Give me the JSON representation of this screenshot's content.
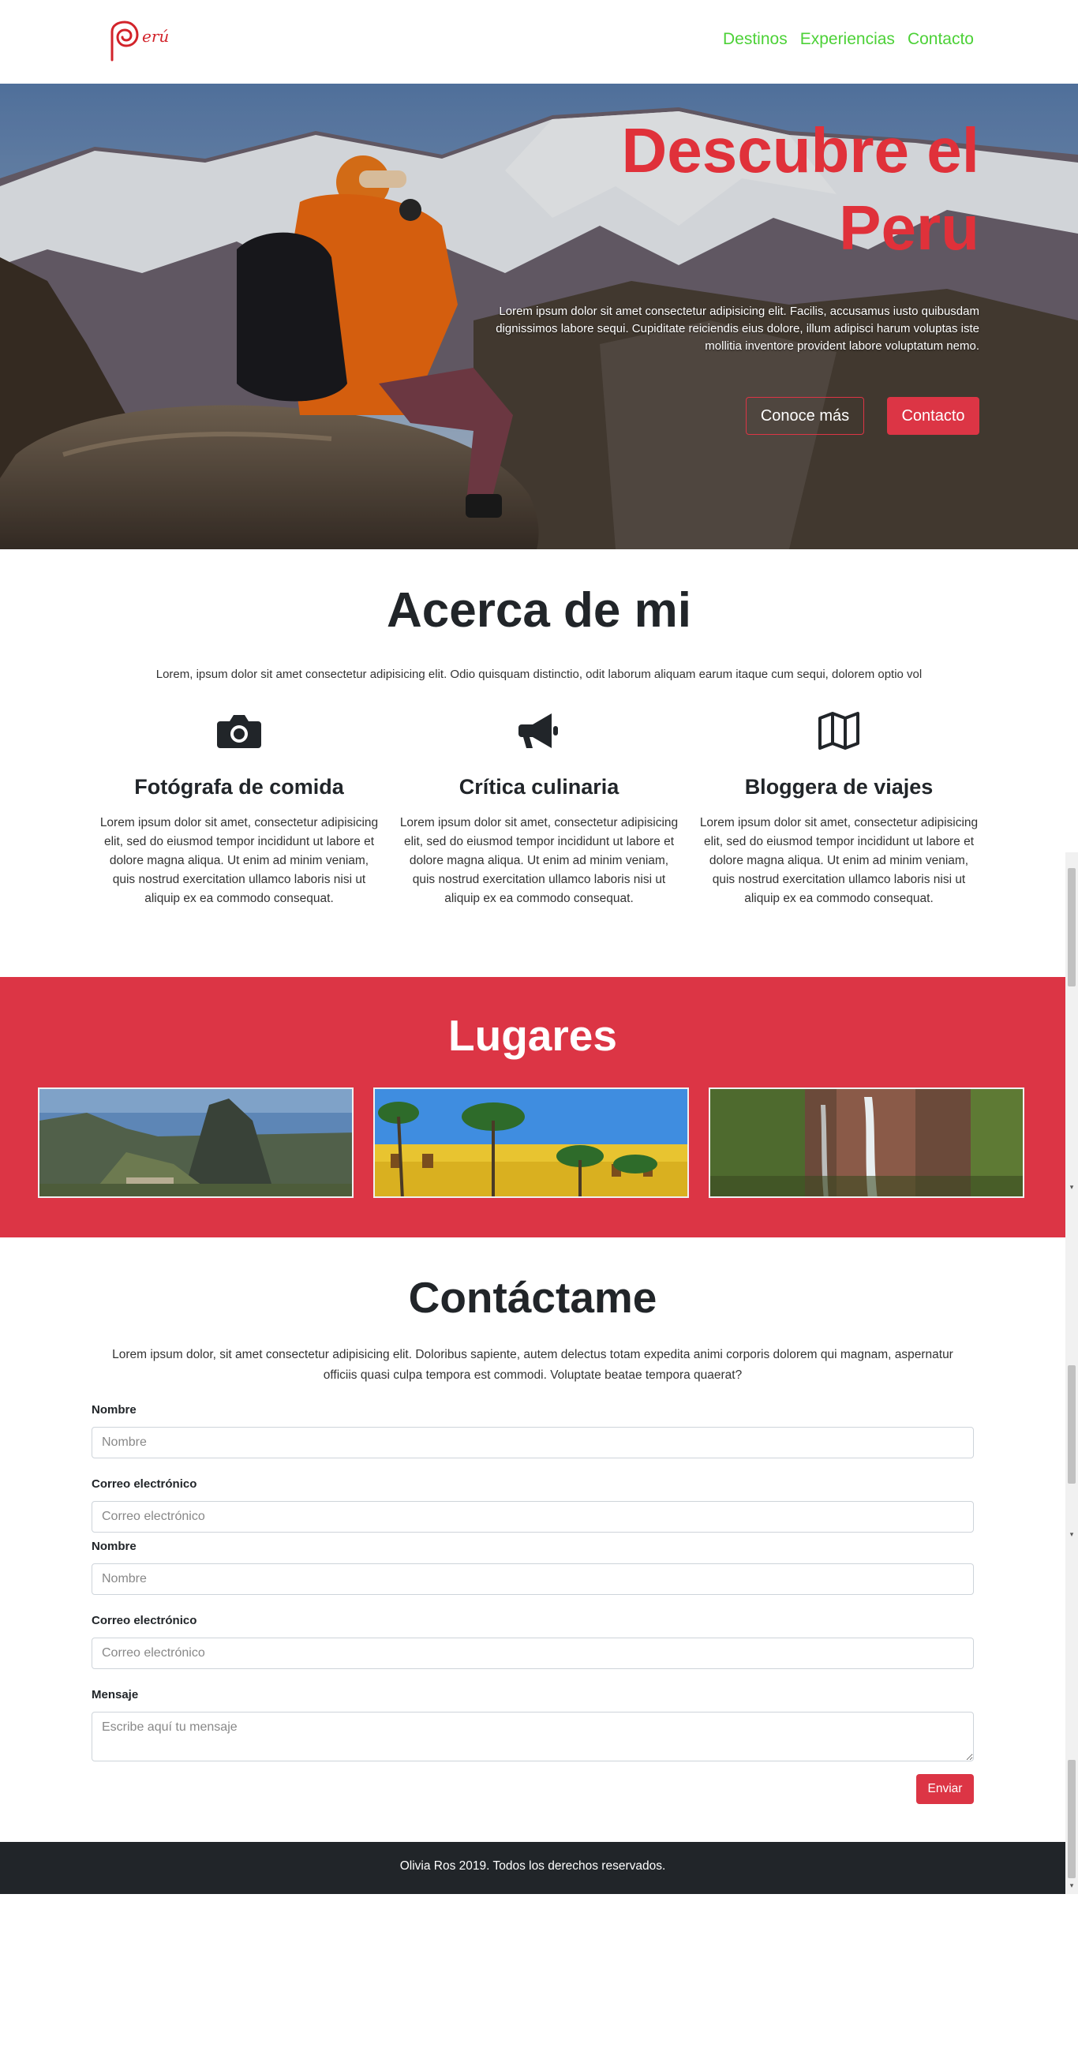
{
  "header": {
    "logo_text": "erú",
    "nav": [
      "Destinos",
      "Experiencias",
      "Contacto"
    ]
  },
  "hero": {
    "title": "Descubre el Peru",
    "text": "Lorem ipsum dolor sit amet consectetur adipisicing elit. Facilis, accusamus iusto quibusdam dignissimos labore sequi. Cupiditate reiciendis eius dolore, illum adipisci harum voluptas iste mollitia inventore provident labore voluptatum nemo.",
    "btn_more": "Conoce más",
    "btn_contact": "Contacto"
  },
  "about": {
    "title": "Acerca de mi",
    "lead": "Lorem, ipsum dolor sit amet consectetur adipisicing elit. Odio quisquam distinctio, odit laborum aliquam earum itaque cum sequi, dolorem optio vol",
    "features": [
      {
        "icon": "camera-icon",
        "title": "Fotógrafa de comida",
        "text": "Lorem ipsum dolor sit amet, consectetur adipisicing elit, sed do eiusmod tempor incididunt ut labore et dolore magna aliqua. Ut enim ad minim veniam, quis nostrud exercitation ullamco laboris nisi ut aliquip ex ea commodo consequat."
      },
      {
        "icon": "megaphone-icon",
        "title": "Crítica culinaria",
        "text": "Lorem ipsum dolor sit amet, consectetur adipisicing elit, sed do eiusmod tempor incididunt ut labore et dolore magna aliqua. Ut enim ad minim veniam, quis nostrud exercitation ullamco laboris nisi ut aliquip ex ea commodo consequat."
      },
      {
        "icon": "map-icon",
        "title": "Bloggera de viajes",
        "text": "Lorem ipsum dolor sit amet, consectetur adipisicing elit, sed do eiusmod tempor incididunt ut labore et dolore magna aliqua. Ut enim ad minim veniam, quis nostrud exercitation ullamco laboris nisi ut aliquip ex ea commodo consequat."
      }
    ]
  },
  "places": {
    "title": "Lugares",
    "items": [
      "machu-picchu-photo",
      "lima-plaza-palms-photo",
      "waterfall-photo"
    ]
  },
  "contact": {
    "title": "Contáctame",
    "lead": "Lorem ipsum dolor, sit amet consectetur adipisicing elit. Doloribus sapiente, autem delectus totam expedita animi corporis dolorem qui magnam, aspernatur officiis quasi culpa tempora est commodi. Voluptate beatae tempora quaerat?",
    "name_label": "Nombre",
    "name_placeholder": "Nombre",
    "email_label": "Correo electrónico",
    "email_placeholder": "Correo electrónico",
    "message_label": "Mensaje",
    "message_placeholder": "Escribe aquí tu mensaje",
    "send": "Enviar"
  },
  "footer": {
    "text": "Olivia Ros 2019. Todos los derechos reservados."
  },
  "colors": {
    "accent_red": "#dc3545",
    "nav_green": "#4cd137",
    "dark": "#212529"
  }
}
